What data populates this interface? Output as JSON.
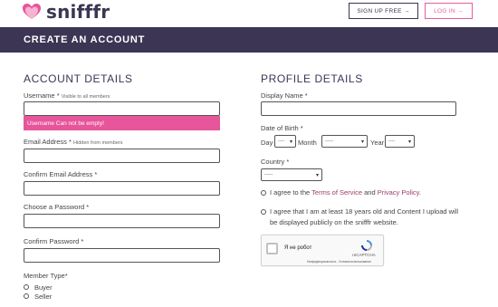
{
  "header": {
    "logo_text": "snifffr",
    "signup_label": "SIGN UP FREE →",
    "login_label": "LOG IN →"
  },
  "page_title": "CREATE AN ACCOUNT",
  "account": {
    "title": "ACCOUNT DETAILS",
    "username_label": "Username",
    "username_req": "*",
    "username_hint": "Visible to all members",
    "username_value": "",
    "username_error": "Username Can not be empty!",
    "email_label": "Email Address",
    "email_req": "*",
    "email_hint": "Hidden from members",
    "email_value": "",
    "confirm_email_label": "Confirm Email Address *",
    "confirm_email_value": "",
    "password_label": "Choose a Password *",
    "password_value": "",
    "confirm_password_label": "Confirm Password *",
    "confirm_password_value": "",
    "member_type_label": "Member Type*",
    "member_types": [
      "Buyer",
      "Seller"
    ]
  },
  "profile": {
    "title": "PROFILE DETAILS",
    "display_name_label": "Display Name *",
    "display_name_value": "",
    "dob_label": "Date of Birth *",
    "day_label": "Day",
    "month_label": "Month",
    "year_label": "Year",
    "day_value": "----",
    "month_value": "-----",
    "year_value": "----",
    "country_label": "Country *",
    "country_value": "-----",
    "terms_prefix": "I agree to the",
    "terms_link": "Terms of Service",
    "terms_and": "and",
    "privacy_link": "Privacy Policy",
    "terms_suffix": ".",
    "age_agree_line1": "I agree that I am at least 18 years old and Content I upload will",
    "age_agree_line2": "be displayed publicly on the snifffr website."
  },
  "captcha": {
    "label": "Я не робот",
    "brand": "reCAPTCHA",
    "links": "Конфиденциальность - Условия использования"
  },
  "colors": {
    "brand_dark": "#3c3554",
    "brand_pink": "#e95b9b",
    "error_bg": "#e7559a",
    "link": "#9b3b6b"
  }
}
